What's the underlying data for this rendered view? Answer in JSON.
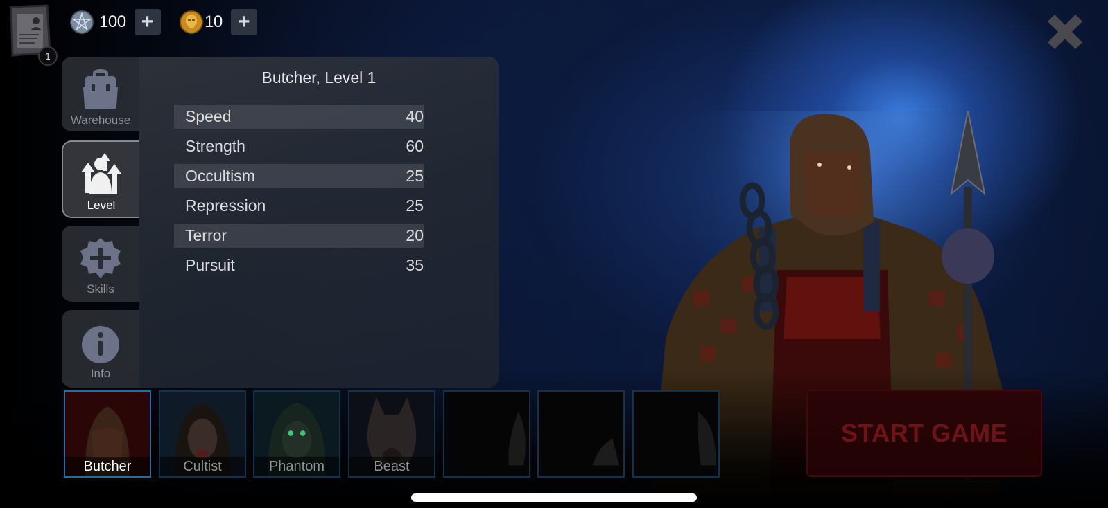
{
  "topbar": {
    "profile": {
      "icon": "dossier-icon",
      "badge": "1"
    },
    "currencies": [
      {
        "icon": "pentagram-coin-icon",
        "amount": "100",
        "add_label": "+"
      },
      {
        "icon": "gold-skull-coin-icon",
        "amount": "10",
        "add_label": "+"
      }
    ],
    "close_icon": "close-icon"
  },
  "side_tabs": [
    {
      "label": "Warehouse",
      "icon": "backpack-icon",
      "active": false
    },
    {
      "label": "Level",
      "icon": "level-up-icon",
      "active": true
    },
    {
      "label": "Skills",
      "icon": "skill-plus-icon",
      "active": false
    },
    {
      "label": "Info",
      "icon": "info-icon",
      "active": false
    }
  ],
  "panel": {
    "title": "Butcher, Level 1",
    "stats": [
      {
        "name": "Speed",
        "value": "40"
      },
      {
        "name": "Strength",
        "value": "60"
      },
      {
        "name": "Occultism",
        "value": "25"
      },
      {
        "name": "Repression",
        "value": "25"
      },
      {
        "name": "Terror",
        "value": "20"
      },
      {
        "name": "Pursuit",
        "value": "35"
      }
    ]
  },
  "characters": [
    {
      "name": "Butcher",
      "locked": false,
      "selected": true
    },
    {
      "name": "Cultist",
      "locked": false,
      "selected": false
    },
    {
      "name": "Phantom",
      "locked": false,
      "selected": false
    },
    {
      "name": "Beast",
      "locked": false,
      "selected": false
    },
    {
      "name": "",
      "locked": true,
      "selected": false
    },
    {
      "name": "",
      "locked": true,
      "selected": false
    },
    {
      "name": "",
      "locked": true,
      "selected": false
    }
  ],
  "start_button": {
    "label": "START GAME"
  },
  "colors": {
    "accent_blue": "#1b6fb0",
    "start_red": "#6e1418",
    "panel_bg": "#30343c"
  }
}
